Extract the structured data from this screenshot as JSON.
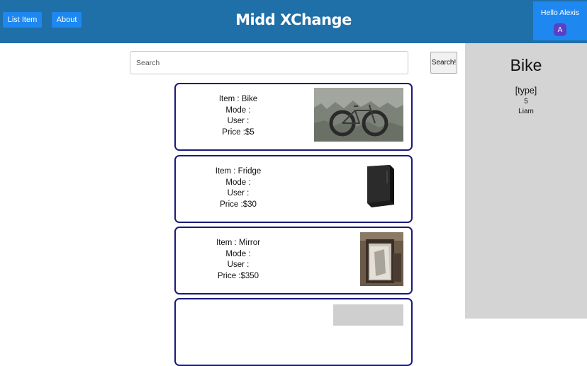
{
  "header": {
    "nav": {
      "list_item": "List Item",
      "about": "About"
    },
    "brand": "Midd XChange",
    "user": {
      "greeting": "Hello Alexis",
      "avatar_initial": "A"
    }
  },
  "search": {
    "placeholder": "Search",
    "button": "Search!"
  },
  "items": [
    {
      "item": "Item : Bike",
      "mode": "Mode :",
      "user": "User :",
      "price": "Price :$5",
      "image": "bike-photo"
    },
    {
      "item": "Item : Fridge",
      "mode": "Mode :",
      "user": "User :",
      "price": "Price :$30",
      "image": "fridge-photo"
    },
    {
      "item": "Item : Mirror",
      "mode": "Mode :",
      "user": "User :",
      "price": "Price :$350",
      "image": "mirror-photo"
    },
    {
      "image": "item-photo"
    }
  ],
  "detail": {
    "title": "Bike",
    "type": "[type]",
    "price": "5",
    "user": "Liam"
  },
  "colors": {
    "header": "#1f6fa8",
    "button": "#1e88f0",
    "avatar": "#5b3fc6",
    "card_border": "#1a1a7a",
    "sidebar": "#d4d4d4"
  }
}
